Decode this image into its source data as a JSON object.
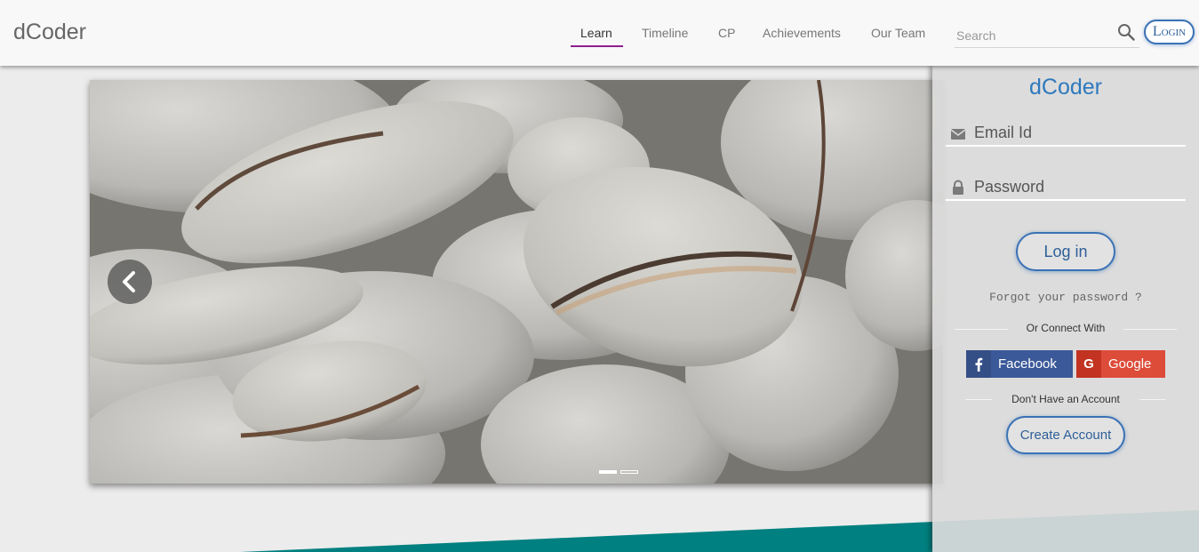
{
  "header": {
    "brand": "dCoder",
    "nav": [
      {
        "label": "Learn",
        "active": true
      },
      {
        "label": "Timeline"
      },
      {
        "label": "CP"
      },
      {
        "label": "Achievements"
      },
      {
        "label": "Our Team"
      }
    ],
    "search": {
      "placeholder": "Search",
      "value": ""
    },
    "login_label": "Login"
  },
  "carousel": {
    "image": "grey pebbles photo",
    "slide_count": 2,
    "active_slide": 1
  },
  "login_panel": {
    "title": "dCoder",
    "email_placeholder": "Email Id",
    "password_placeholder": "Password",
    "login_button": "Log in",
    "forgot": "Forgot your password ?",
    "connect_text": "Or Connect With",
    "facebook": "Facebook",
    "google": "Google",
    "no_account_text": "Don't Have an Account",
    "create_account": "Create Account"
  },
  "colors": {
    "accent_underline": "#8e1f8e",
    "brand_blue": "#2e79bd",
    "button_border": "#3a72b5",
    "facebook": "#3b5998",
    "google": "#dd4b39",
    "teal": "#008080"
  },
  "icons": [
    "search-icon",
    "mail-icon",
    "lock-icon",
    "chevron-left-icon",
    "facebook-icon",
    "google-icon"
  ]
}
